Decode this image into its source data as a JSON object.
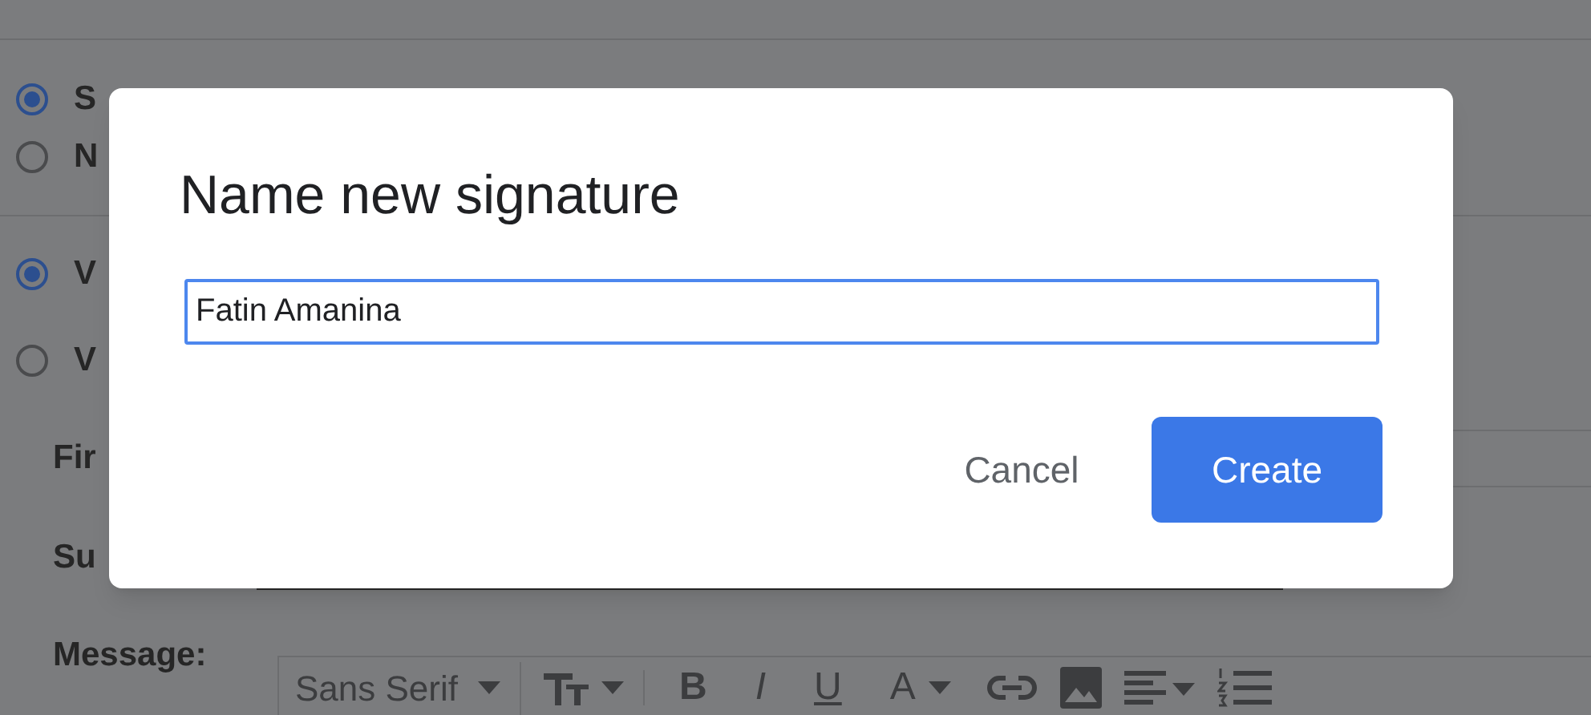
{
  "settings": {
    "radio_groups": [
      [
        {
          "label": "S",
          "selected": true
        },
        {
          "label": "N",
          "selected": false
        }
      ],
      [
        {
          "label": "V",
          "selected": true
        },
        {
          "label": "V",
          "selected": false
        }
      ]
    ],
    "fields": [
      {
        "label": "Fir"
      },
      {
        "label": "Su"
      },
      {
        "label": "Message:"
      }
    ],
    "toolbar": {
      "font": "Sans Serif",
      "format_buttons": [
        "B",
        "I",
        "U",
        "A"
      ]
    }
  },
  "dialog": {
    "title": "Name new signature",
    "input_value": "Fatin Amanina",
    "buttons": [
      {
        "label": "Cancel",
        "kind": "text"
      },
      {
        "label": "Create",
        "kind": "primary"
      }
    ]
  }
}
